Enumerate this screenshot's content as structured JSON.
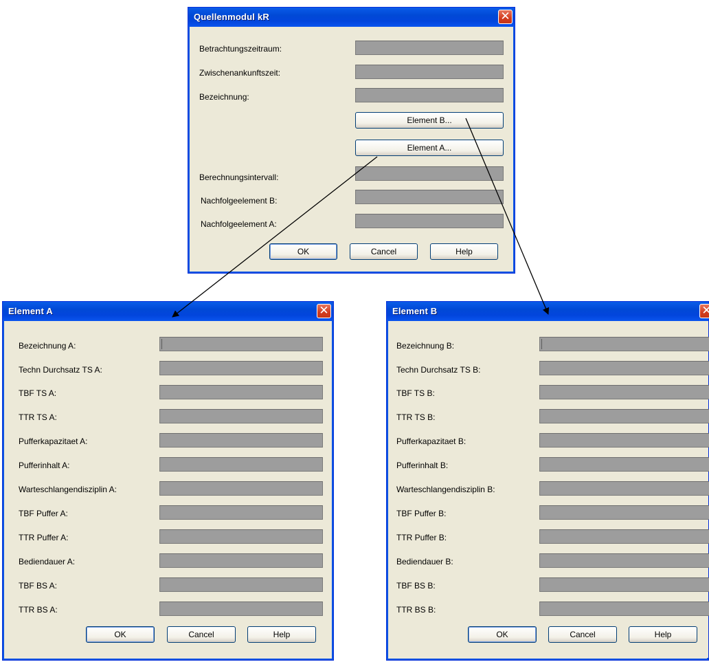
{
  "quellen": {
    "title": "Quellenmodul kR",
    "close_glyph": "✕",
    "labels": {
      "betrachtungszeitraum": "Betrachtungszeitraum:",
      "zwischenankunftszeit": "Zwischenankunftszeit:",
      "bezeichnung": "Bezeichnung:",
      "berechnungsintervall": "Berechnungsintervall:",
      "nachfolge_b": "Nachfolgeelement B:",
      "nachfolge_a": "Nachfolgeelement A:"
    },
    "element_b_button": "Element B...",
    "element_a_button": "Element A...",
    "ok": "OK",
    "cancel": "Cancel",
    "help": "Help"
  },
  "element_a": {
    "title": "Element A",
    "close_glyph": "✕",
    "labels": [
      "Bezeichnung A:",
      "Techn Durchsatz TS A:",
      "TBF TS A:",
      "TTR TS A:",
      "Pufferkapazitaet A:",
      "Pufferinhalt A:",
      "Warteschlangendisziplin A:",
      "TBF Puffer A:",
      "TTR Puffer A:",
      "Bediendauer A:",
      "TBF BS A:",
      "TTR BS A:"
    ],
    "ok": "OK",
    "cancel": "Cancel",
    "help": "Help"
  },
  "element_b": {
    "title": "Element B",
    "close_glyph": "✕",
    "labels": [
      "Bezeichnung B:",
      "Techn Durchsatz TS B:",
      "TBF TS B:",
      "TTR TS B:",
      "Pufferkapazitaet B:",
      "Pufferinhalt B:",
      "Warteschlangendisziplin B:",
      "TBF Puffer B:",
      "TTR Puffer B:",
      "Bediendauer B:",
      "TBF BS B:",
      "TTR BS B:"
    ],
    "ok": "OK",
    "cancel": "Cancel",
    "help": "Help"
  },
  "colors": {
    "titlebar": "#0149d6",
    "dialog_bg": "#ece9d8",
    "field_bg": "#9d9d9d",
    "close_button": "#d33c1e"
  }
}
